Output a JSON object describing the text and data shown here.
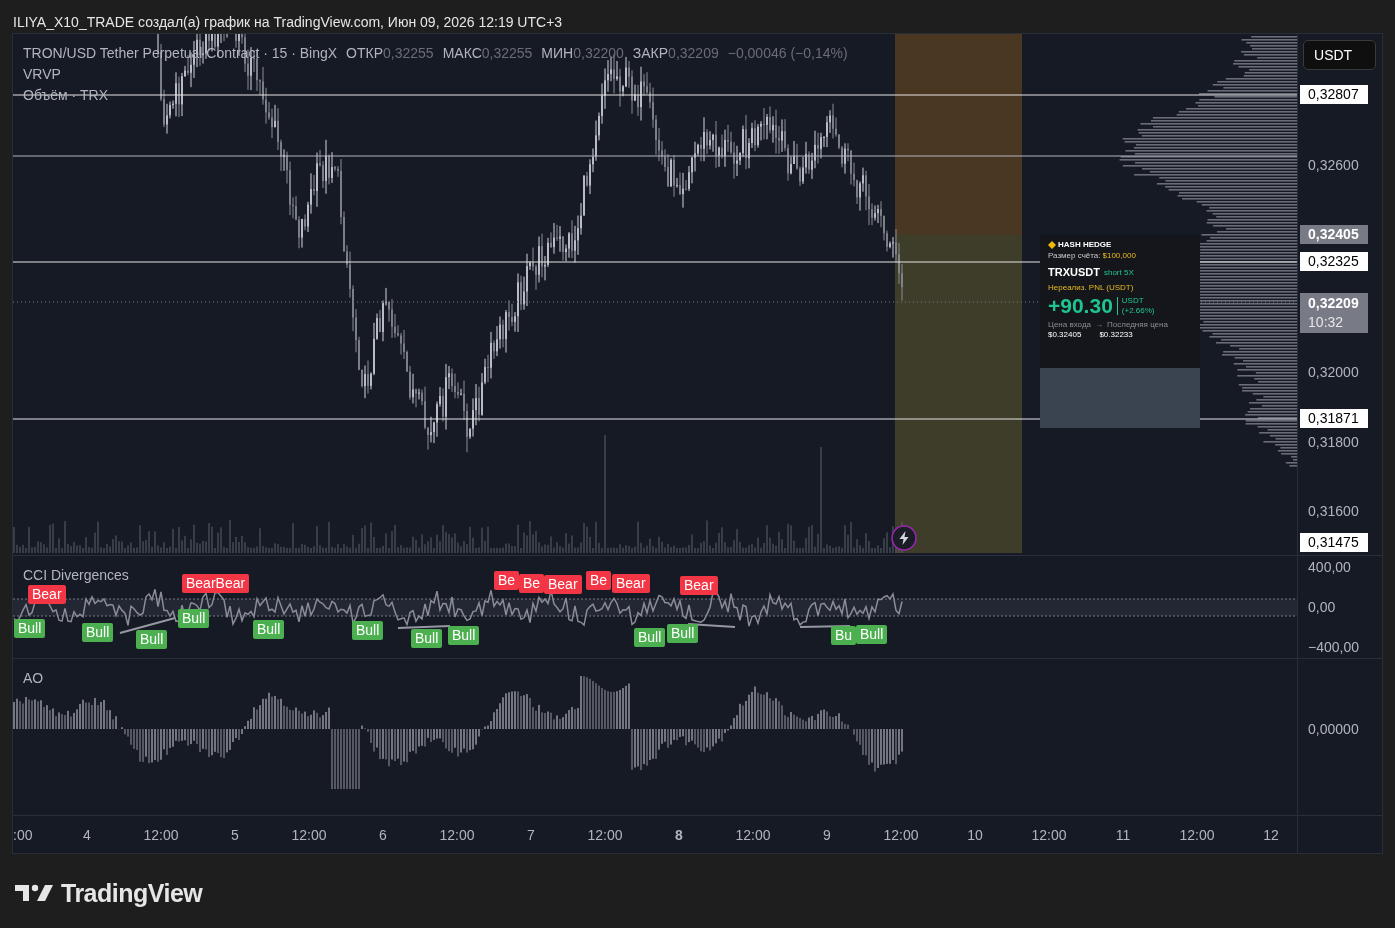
{
  "header": {
    "text": "ILIYA_X10_TRADE создал(а) график на TradingView.com, Июн 09, 2026 12:19 UTC+3"
  },
  "legend": {
    "symbol": "TRON/USD Tether Perpetual Contract · 15 · BingX",
    "ohlc": [
      {
        "label": "ОТКР",
        "value": "0,32255"
      },
      {
        "label": "МАКС",
        "value": "0,32255"
      },
      {
        "label": "МИН",
        "value": "0,32200"
      },
      {
        "label": "ЗАКР",
        "value": "0,32209"
      }
    ],
    "change": "−0,00046 (−0,14%)",
    "indicators": [
      "VRVP",
      "Объём · TRX"
    ]
  },
  "price_axis": {
    "currency_button": "USDT",
    "labels": [
      {
        "text": "0,32807",
        "kind": "line"
      },
      {
        "text": "0,32600",
        "kind": "plain"
      },
      {
        "text": "0,32405",
        "kind": "entry"
      },
      {
        "text": "0,32325",
        "kind": "line"
      },
      {
        "text": "0,32209",
        "time": "10:32",
        "kind": "current"
      },
      {
        "text": "0,32000",
        "kind": "plain"
      },
      {
        "text": "0,31871",
        "kind": "line"
      },
      {
        "text": "0,31800",
        "kind": "plain"
      },
      {
        "text": "0,31600",
        "kind": "plain"
      },
      {
        "text": "0,31475",
        "kind": "line"
      }
    ]
  },
  "pnl_card": {
    "brand": "HASH HEDGE",
    "account_label": "Размер счёта:",
    "account_value": "$100,000",
    "pair": "TRXUSDT",
    "side": "short 5X",
    "pnl_label": "Нереализ. PNL (USDT)",
    "pnl": "+90.30",
    "pnl_unit": "USDT",
    "pnl_percent": "(+2.66%)",
    "entry_label": "Цена входа",
    "arrow": "→",
    "last_label": "Последняя цена",
    "entry_price": "$0.32405",
    "last_price": "$0.32233"
  },
  "cci": {
    "title": "CCI Divergences",
    "axis": [
      "400,00",
      "0,00",
      "−400,00"
    ],
    "markers": [
      {
        "label": "Bear",
        "kind": "bear"
      },
      {
        "label": "Bull",
        "kind": "bull"
      },
      {
        "label": "Bull",
        "kind": "bull"
      },
      {
        "label": "Bull",
        "kind": "bull"
      },
      {
        "label": "BearBear",
        "kind": "bear"
      },
      {
        "label": "Bull",
        "kind": "bull"
      },
      {
        "label": "Bull",
        "kind": "bull"
      },
      {
        "label": "Bull",
        "kind": "bull"
      },
      {
        "label": "Bull",
        "kind": "bull"
      },
      {
        "label": "Bull",
        "kind": "bull"
      },
      {
        "label": "Be",
        "kind": "bear"
      },
      {
        "label": "Be",
        "kind": "bear"
      },
      {
        "label": "Bear",
        "kind": "bear"
      },
      {
        "label": "Be",
        "kind": "bear"
      },
      {
        "label": "Bear",
        "kind": "bear"
      },
      {
        "label": "Bear",
        "kind": "bear"
      },
      {
        "label": "Bull",
        "kind": "bull"
      },
      {
        "label": "Bull",
        "kind": "bull"
      },
      {
        "label": "Bu",
        "kind": "bull"
      },
      {
        "label": "Bull",
        "kind": "bull"
      }
    ]
  },
  "ao": {
    "title": "AO",
    "axis": [
      "0,00000"
    ]
  },
  "time_axis": [
    {
      "text": ":00",
      "bold": false
    },
    {
      "text": "4",
      "bold": false
    },
    {
      "text": "12:00",
      "bold": false
    },
    {
      "text": "5",
      "bold": false
    },
    {
      "text": "12:00",
      "bold": false
    },
    {
      "text": "6",
      "bold": false
    },
    {
      "text": "12:00",
      "bold": false
    },
    {
      "text": "7",
      "bold": false
    },
    {
      "text": "12:00",
      "bold": false
    },
    {
      "text": "8",
      "bold": true
    },
    {
      "text": "12:00",
      "bold": false
    },
    {
      "text": "9",
      "bold": false
    },
    {
      "text": "12:00",
      "bold": false
    },
    {
      "text": "10",
      "bold": false
    },
    {
      "text": "12:00",
      "bold": false
    },
    {
      "text": "11",
      "bold": false
    },
    {
      "text": "12:00",
      "bold": false
    },
    {
      "text": "12",
      "bold": false
    }
  ],
  "footer": {
    "logo": "TradingView"
  }
}
